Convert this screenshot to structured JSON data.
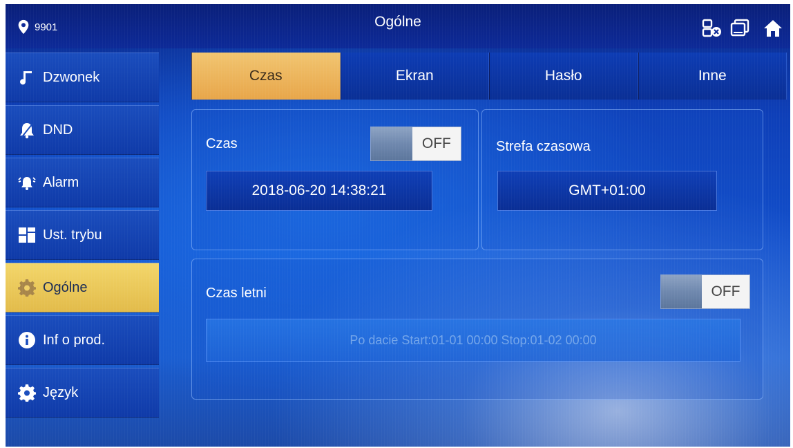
{
  "header": {
    "device_number": "9901",
    "title": "Ogólne"
  },
  "sidebar": {
    "items": [
      {
        "label": "Dzwonek",
        "icon": "music-note-icon"
      },
      {
        "label": "DND",
        "icon": "bell-mute-icon"
      },
      {
        "label": "Alarm",
        "icon": "alarm-bell-icon"
      },
      {
        "label": "Ust. trybu",
        "icon": "mode-grid-icon"
      },
      {
        "label": "Ogólne",
        "icon": "gear-icon"
      },
      {
        "label": "Inf o prod.",
        "icon": "info-icon"
      },
      {
        "label": "Język",
        "icon": "gear-icon"
      }
    ],
    "active_index": 4
  },
  "tabs": [
    {
      "label": "Czas"
    },
    {
      "label": "Ekran"
    },
    {
      "label": "Hasło"
    },
    {
      "label": "Inne"
    }
  ],
  "time_panel": {
    "label": "Czas",
    "toggle_state": "OFF",
    "datetime": "2018-06-20 14:38:21"
  },
  "timezone_panel": {
    "label": "Strefa czasowa",
    "value": "GMT+01:00"
  },
  "dst_panel": {
    "label": "Czas letni",
    "toggle_state": "OFF",
    "schedule": "Po dacie Start:01-01 00:00  Stop:01-02 00:00"
  },
  "colors": {
    "active_sidebar": "#e9c65a",
    "active_tab": "#eeb85e",
    "background": "#1250cc"
  }
}
